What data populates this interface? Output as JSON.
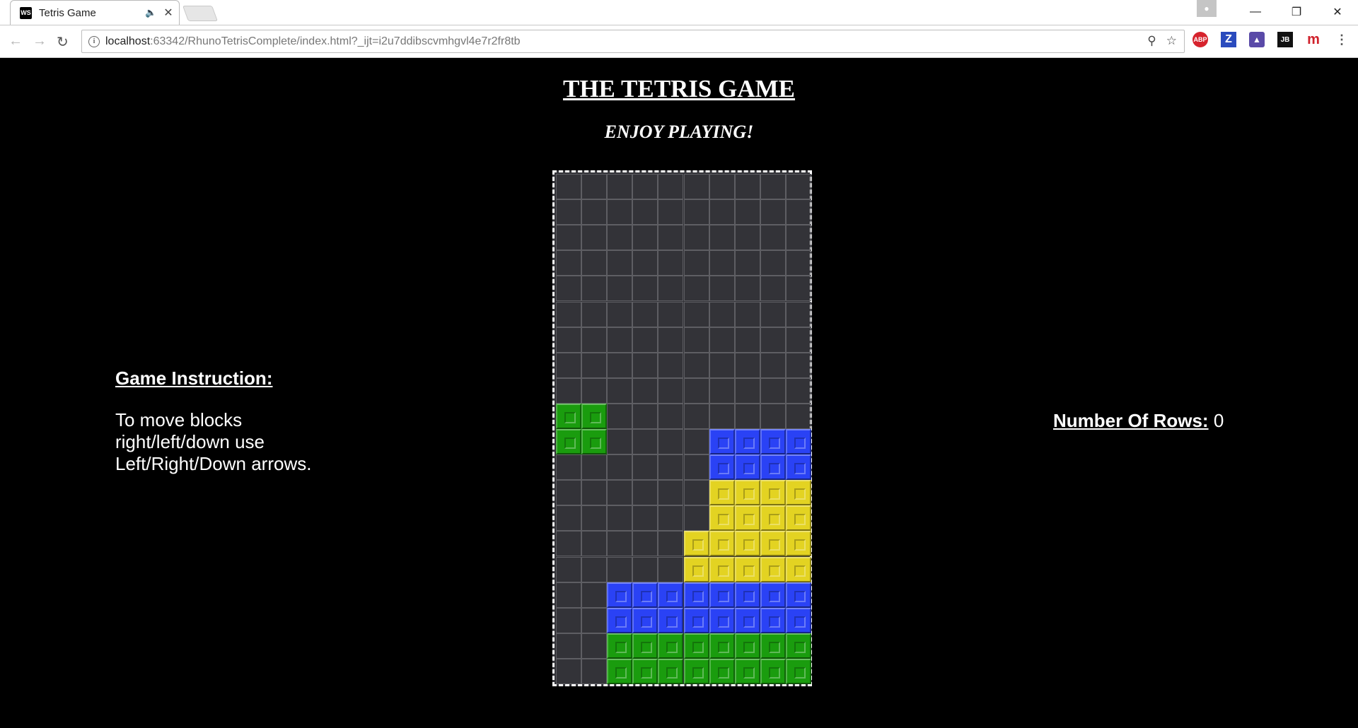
{
  "browser": {
    "tab_title": "Tetris Game",
    "tab_favicon": "WS",
    "url_host": "localhost",
    "url_rest": ":63342/RhunoTetrisComplete/index.html?_ijt=i2u7ddibscvmhgvl4e7r2fr8tb",
    "extensions": [
      "ABP",
      "Z",
      "map-icon",
      "JB",
      "m"
    ]
  },
  "page": {
    "title": "THE TETRIS GAME",
    "subtitle": "ENJOY PLAYING!",
    "instructions": {
      "heading": "Game Instruction:",
      "lines": [
        "To move blocks",
        "right/left/down use",
        "Left/Right/Down arrows."
      ]
    },
    "rows": {
      "label": "Number Of Rows:",
      "value": "0"
    }
  },
  "board": {
    "columns": 10,
    "rows": 20,
    "colors": {
      "G": "#1a9c0e",
      "B": "#2a42f5",
      "Y": "#e3d322"
    },
    "cells": [
      "..........",
      "..........",
      "..........",
      "..........",
      "..........",
      "..........",
      "..........",
      "..........",
      "..........",
      "GG........",
      "GG....BBBB",
      "......BBBB",
      "......YYYY",
      "......YYYY",
      ".....YYYYY",
      ".....YYYYY",
      "..BBBBBBBB",
      "..BBBBBBBB",
      "..GGGGGGGG",
      "..GGGGGGGG"
    ]
  }
}
